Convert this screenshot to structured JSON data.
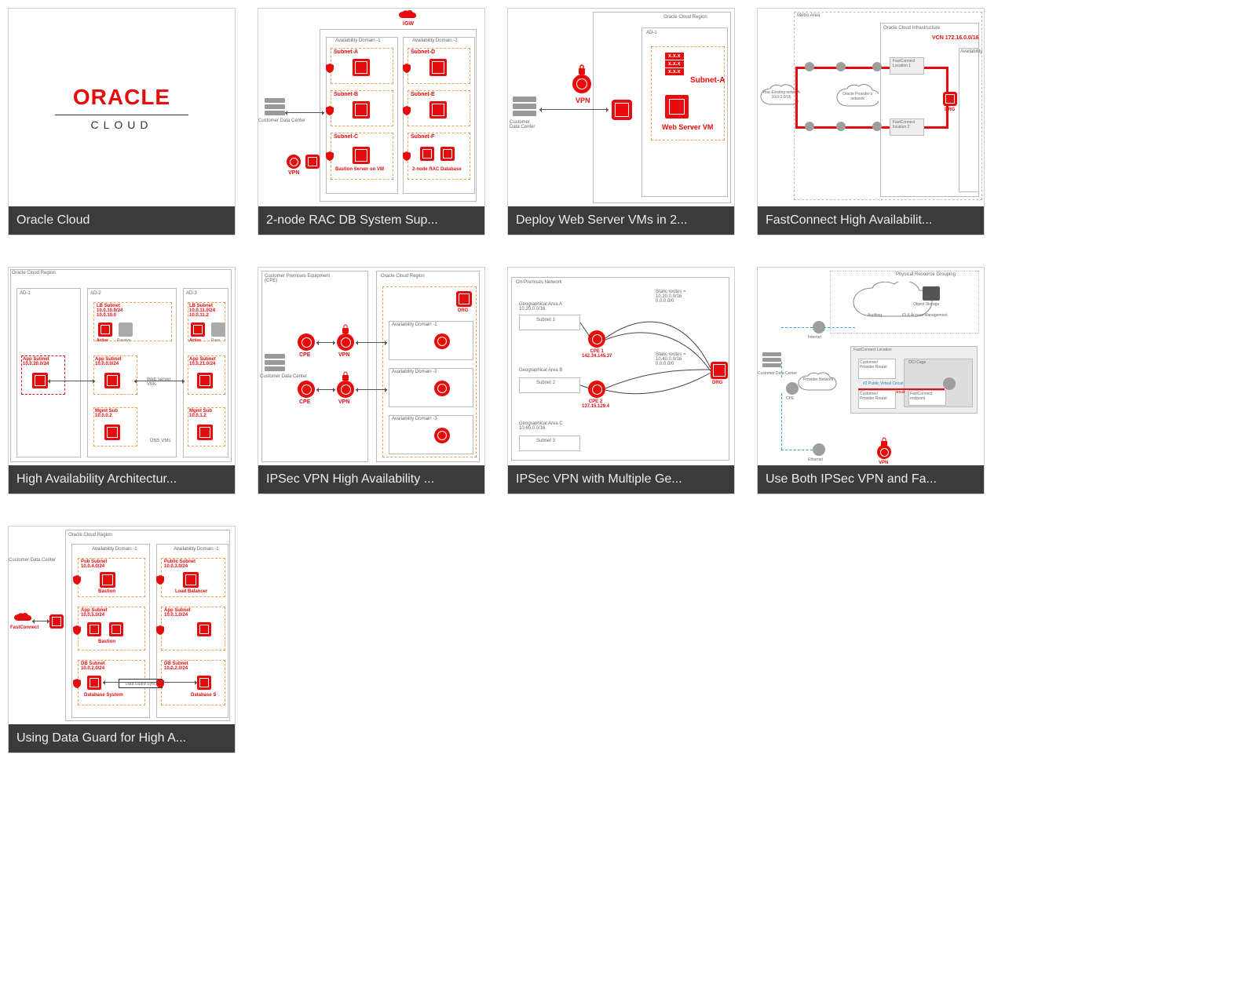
{
  "cards": [
    {
      "title": "Oracle Cloud",
      "logo_top": "ORACLE",
      "logo_bottom": "CLOUD"
    },
    {
      "title": "2-node RAC DB System Sup...",
      "region": "",
      "ad1": "Availability Domain -1",
      "ad2": "Availability Domain -2",
      "igw": "IGW",
      "subnets": [
        "Subnet-A",
        "Subnet-D",
        "Subnet-B",
        "Subnet-E",
        "Subnet-C",
        "Subnet-F"
      ],
      "cdc": "Customer Data Center",
      "vpn": "VPN",
      "bastion": "Bastion Server on VM",
      "rac": "2-node RAC Database"
    },
    {
      "title": "Deploy Web Server VMs in 2...",
      "region": "Oracle Cloud Region",
      "ad": "AD-1",
      "vpn": "VPN",
      "drg": "DRG",
      "cdc": "Customer\nData Center",
      "subnet": "Subnet-A",
      "ws": "Web Server VM",
      "xxx": "x.x.x"
    },
    {
      "title": "FastConnect High Availabilit...",
      "metro": "Metro Area",
      "oci": "Oracle Cloud Infrastructure",
      "vcn": "VCN 172.16.0.0/16",
      "avail": "Availability",
      "yen": "Your Existing network\n10.0.0.0/16",
      "opn": "Oracle Provider's\nnetwork",
      "fc1": "FastConnect\nLocation 1",
      "fc2": "FastConnect\nlocation 2",
      "drg": "DRG"
    },
    {
      "title": "High Availability Architectur...",
      "region": "Oracle Cloud Region",
      "ad1": "AD-1",
      "ad2": "AD-2",
      "ad3": "AD-3",
      "lb1": "LB Subnet\n10.0.10.0/24\n10.0.10.0",
      "lb2": "LB Subnet\n10.0.11.0/24\n10.0.11.2",
      "active": "Active",
      "passive": "Passive",
      "app1": "App Subnet\n10.0.20.0/24",
      "app2": "App Subnet\n10.0.0.0/24",
      "app3": "App Subnet\n10.0.21.0/24",
      "ws": "Web server\nVMs",
      "mg1": "Mgmt Sub\n10.0.0.2",
      "mg2": "Mgmt Sub\n10.0.1.2",
      "dns": "DNS VMs"
    },
    {
      "title": "IPSec VPN High Availability ...",
      "cpe_title": "Customer Premises Equipment\n(CPE)",
      "region": "Oracle Cloud Region",
      "cdc": "Customer Data Center",
      "cpe": "CPE",
      "vpn": "VPN",
      "drg": "DRG",
      "ad1": "Availability Domain -1",
      "ad2": "Availability Domain -2",
      "ad3": "Availability Domain -3"
    },
    {
      "title": "IPSec VPN with Multiple Ge...",
      "onprem": "On-Premises Network",
      "ga": "Geographical Area A\n10.20.0.0/16",
      "s1": "Subnet 1",
      "c1": "CPE 1\n142.34.145.37",
      "gb": "Geographical Area B",
      "s2": "Subnet 2",
      "c2": "CPE 2\n137.15.129.4",
      "gc": "Geographical Area C\n10.60.0.0/16",
      "s3": "Subnet 3",
      "sr1": "Static routes =\n10.20.0.0/16\n0.0.0.0/0",
      "sr2": "Static routes =\n10.40.0.0/16\n0.0.0.0/0",
      "drg": "DRG"
    },
    {
      "title": "Use Both IPSec VPN and Fa...",
      "prg": "Physical Resource Grouping",
      "obj": "Object Storage",
      "iam": "ID & Access Management",
      "aud": "Auditing",
      "inet": "Internet",
      "cdc": "Customer Data Center",
      "pn": "Provider Network",
      "cpe": "CPE",
      "fcloc": "FastConnect Location",
      "cpr": "Customer/\nProvider Router",
      "cage": "OCI Cage",
      "pubvc": "#2 Public Virtual Circuit",
      "prvvc": "#1 Private Virtual Circuit",
      "fce": "FastConnect\nendpoint",
      "vpn": "VPN",
      "eth": "Ethernet"
    },
    {
      "title": "Using Data Guard for High A...",
      "region": "Oracle Cloud Region",
      "ad1": "Availability Domain -1",
      "ad2": "Availability Domain -1",
      "cdc": "Customer Data Center",
      "pub1": "Pub Subnet\n10.0.4.0/24",
      "pub2": "Public Subnet\n10.0.3.0/24",
      "bastion": "Bastion",
      "lb": "Load Balancer",
      "app1": "App Subnet\n10.0.5.0/24",
      "app2": "App Subnet\n10.0.1.0/24",
      "db1": "DB Subnet\n10.0.2.0/24",
      "db2": "DB Subnet\n10.0.2.0/24",
      "dbsys": "Database System",
      "dbsys2": "Database S",
      "dgs": "Data Guard Sync",
      "fc": "FastConnect"
    }
  ]
}
